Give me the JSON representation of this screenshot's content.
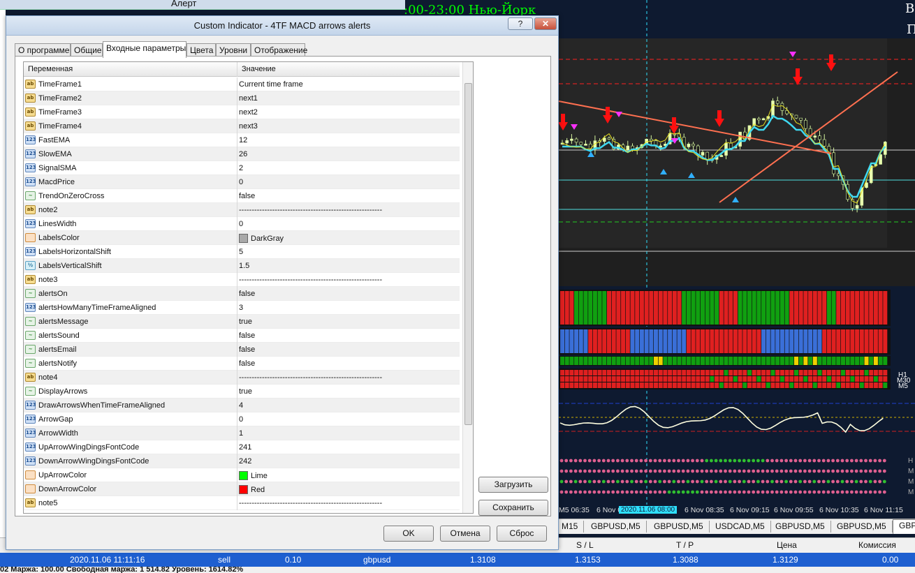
{
  "background": {
    "alert_window_title": "Алерт",
    "chart_header": ":00-23:00 Нью-Йорк",
    "chart_corner_top": "В",
    "chart_corner_second": "П",
    "tf_labels": [
      "H1",
      "M30",
      "M5"
    ],
    "tf_labels_bottom": [
      "Н",
      "М",
      "М",
      "М"
    ],
    "time_axis": [
      "M5 06:35",
      "6 Nov 0",
      "2020.11.06 08:00",
      "6 Nov 08:35",
      "6 Nov 09:15",
      "6 Nov 09:55",
      "6 Nov 10:35",
      "6 Nov 11:15"
    ],
    "chart_tabs": [
      "M15",
      "GBPUSD,M5",
      "GBPUSD,M5",
      "USDCAD,M5",
      "GBPUSD,M5",
      "GBPUSD,M5",
      "GBP"
    ],
    "terminal_headers": [
      "S / L",
      "T / P",
      "Цена",
      "Комиссия"
    ],
    "terminal_row": {
      "time": "2020.11.06 11:11:16",
      "type": "sell",
      "volume": "0.10",
      "symbol": "gbpusd",
      "price": "1.3108",
      "sl": "1.3153",
      "tp": "1.3088",
      "current": "1.3129",
      "commission": "0.00"
    },
    "terminal_footer": "02 Маржа: 100.00 Свободная маржа: 1 514.82 Уровень: 1614.82%",
    "colors": {
      "chart_bg": "#0e1a30",
      "up": "#00ff00",
      "down": "#ff0000",
      "selection": "#1e5fd0"
    }
  },
  "dialog": {
    "title": "Custom Indicator - 4TF MACD arrows alerts",
    "help_button": "?",
    "close_button": "✕",
    "tabs": [
      {
        "label": "О программе"
      },
      {
        "label": "Общие"
      },
      {
        "label": "Входные параметры"
      },
      {
        "label": "Цвета"
      },
      {
        "label": "Уровни"
      },
      {
        "label": "Отображение"
      }
    ],
    "active_tab": "Входные параметры",
    "columns": {
      "variable": "Переменная",
      "value": "Значение"
    },
    "params": [
      {
        "icon": "ab",
        "name": "TimeFrame1",
        "value": "Current time frame"
      },
      {
        "icon": "ab",
        "name": "TimeFrame2",
        "value": "next1"
      },
      {
        "icon": "ab",
        "name": "TimeFrame3",
        "value": "next2"
      },
      {
        "icon": "ab",
        "name": "TimeFrame4",
        "value": "next3"
      },
      {
        "icon": "num",
        "name": "FastEMA",
        "value": "12"
      },
      {
        "icon": "num",
        "name": "SlowEMA",
        "value": "26"
      },
      {
        "icon": "num",
        "name": "SignalSMA",
        "value": "2"
      },
      {
        "icon": "num",
        "name": "MacdPrice",
        "value": "0"
      },
      {
        "icon": "bool",
        "name": "TrendOnZeroCross",
        "value": "false"
      },
      {
        "icon": "ab",
        "name": "note2",
        "value": "--------------------------------------------------------"
      },
      {
        "icon": "num",
        "name": "LinesWidth",
        "value": "0"
      },
      {
        "icon": "col",
        "name": "LabelsColor",
        "value": "DarkGray",
        "swatch": "#a9a9a9"
      },
      {
        "icon": "num",
        "name": "LabelsHorizontalShift",
        "value": "5"
      },
      {
        "icon": "dbl",
        "name": "LabelsVerticalShift",
        "value": "1.5"
      },
      {
        "icon": "ab",
        "name": "note3",
        "value": "--------------------------------------------------------"
      },
      {
        "icon": "bool",
        "name": "alertsOn",
        "value": "false"
      },
      {
        "icon": "num",
        "name": "alertsHowManyTimeFrameAligned",
        "value": "3"
      },
      {
        "icon": "bool",
        "name": "alertsMessage",
        "value": "true"
      },
      {
        "icon": "bool",
        "name": "alertsSound",
        "value": "false"
      },
      {
        "icon": "bool",
        "name": "alertsEmail",
        "value": "false"
      },
      {
        "icon": "bool",
        "name": "alertsNotify",
        "value": "false"
      },
      {
        "icon": "ab",
        "name": "note4",
        "value": "--------------------------------------------------------"
      },
      {
        "icon": "bool",
        "name": "DisplayArrows",
        "value": "true"
      },
      {
        "icon": "num",
        "name": "DrawArrowsWhenTimeFrameAligned",
        "value": "4"
      },
      {
        "icon": "num",
        "name": "ArrowGap",
        "value": "0"
      },
      {
        "icon": "num",
        "name": "ArrowWidth",
        "value": "1"
      },
      {
        "icon": "num",
        "name": "UpArrowWingDingsFontCode",
        "value": "241"
      },
      {
        "icon": "num",
        "name": "DownArrowWingDingsFontCode",
        "value": "242"
      },
      {
        "icon": "col",
        "name": "UpArrowColor",
        "value": "Lime",
        "swatch": "#00ff00"
      },
      {
        "icon": "col",
        "name": "DownArrowColor",
        "value": "Red",
        "swatch": "#ff0000"
      },
      {
        "icon": "ab",
        "name": "note5",
        "value": "--------------------------------------------------------"
      }
    ],
    "side_buttons": {
      "load": "Загрузить",
      "save": "Сохранить"
    },
    "footer_buttons": {
      "ok": "OK",
      "cancel": "Отмена",
      "reset": "Сброс"
    }
  }
}
